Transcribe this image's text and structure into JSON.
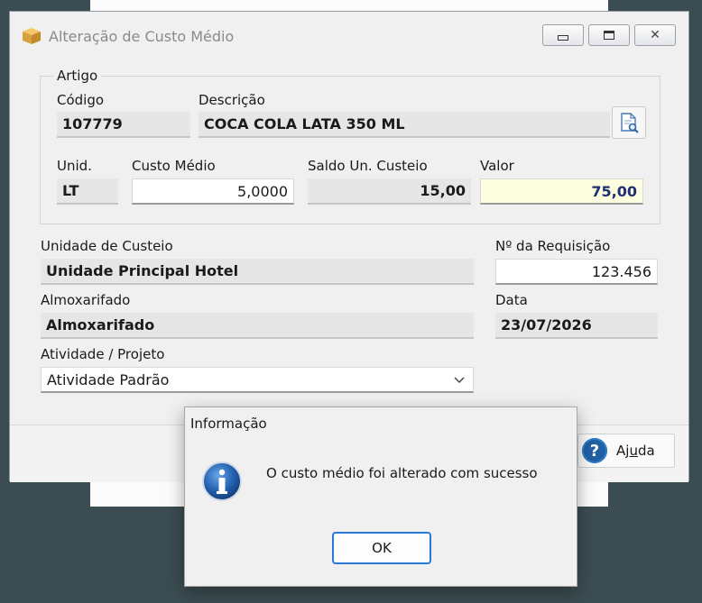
{
  "window": {
    "title": "Alteração de Custo Médio",
    "controls": {
      "minimize": "▭",
      "maximize": "◻",
      "close": "✕"
    }
  },
  "artigo": {
    "legend": "Artigo",
    "codigo_label": "Código",
    "codigo_value": "107779",
    "descricao_label": "Descrição",
    "descricao_value": "COCA COLA LATA 350 ML",
    "unid_label": "Unid.",
    "unid_value": "LT",
    "custo_label": "Custo Médio",
    "custo_value": "5,0000",
    "saldo_label": "Saldo Un. Custeio",
    "saldo_value": "15,00",
    "valor_label": "Valor",
    "valor_value": "75,00"
  },
  "form": {
    "unidade_label": "Unidade de Custeio",
    "unidade_value": "Unidade Principal Hotel",
    "requisicao_label": "Nº da Requisição",
    "requisicao_value": "123.456",
    "almox_label": "Almoxarifado",
    "almox_value": "Almoxarifado",
    "data_label": "Data",
    "data_value": "23/07/2026",
    "atividade_label": "Atividade / Projeto",
    "atividade_value": "Atividade Padrão"
  },
  "footer": {
    "help_label_pre": "Aj",
    "help_label_mnemonic": "u",
    "help_label_post": "da"
  },
  "dialog": {
    "title": "Informação",
    "message": "O custo médio foi alterado com sucesso",
    "ok_label": "OK"
  },
  "icons": {
    "app": "box-icon",
    "lookup": "search-document-icon",
    "help": "help-icon",
    "info": "info-icon"
  },
  "colors": {
    "desktop": "#3b4d52",
    "valor_bg": "#fdfde0",
    "valor_text": "#1f2f74",
    "ok_border": "#2878d4",
    "info_blue": "#1f5fa3"
  }
}
